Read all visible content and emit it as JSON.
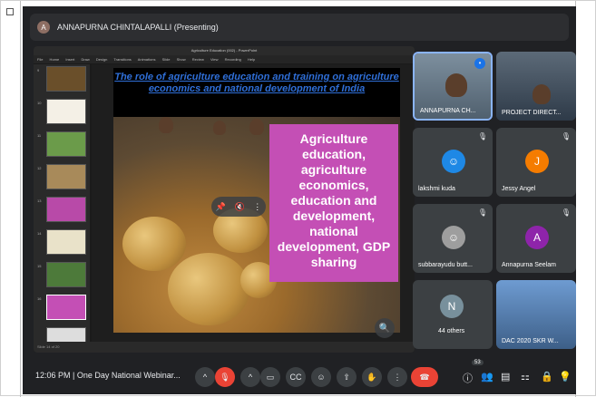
{
  "presenter": {
    "name": "ANNAPURNA CHINTALAPALLI (Presenting)"
  },
  "powerpoint": {
    "window_title": "Agriculture Education (002) - PowerPoint",
    "menu": "File Home Insert Draw Design Transitions Animations Slide Show Review View Recording Help",
    "status": "Slide 14 of 20",
    "slide": {
      "title": "The role of agriculture education and training on agriculture economics and national development of India",
      "box_text": "Agriculture education, agriculture economics, education and development, national development, GDP sharing"
    },
    "slide_numbers": [
      "9",
      "10",
      "11",
      "12",
      "13",
      "14",
      "15",
      "16"
    ]
  },
  "participants": [
    {
      "name": "ANNAPURNA CH...",
      "type": "video",
      "speaking": true
    },
    {
      "name": "PROJECT DIRECT...",
      "type": "video"
    },
    {
      "name": "lakshmi kuda",
      "type": "avatar-image",
      "muted": true
    },
    {
      "name": "Jessy Angel",
      "type": "letter",
      "letter": "J",
      "color": "#f57c00",
      "muted": true
    },
    {
      "name": "subbarayudu butt...",
      "type": "avatar-image",
      "muted": true
    },
    {
      "name": "Annapurna Seelam",
      "type": "letter",
      "letter": "A",
      "color": "#8e24aa",
      "muted": true
    },
    {
      "name": "44 others",
      "type": "others",
      "letter": "N"
    },
    {
      "name": "DAC 2020 SKR W...",
      "type": "video"
    }
  ],
  "bottom_bar": {
    "time": "12:06 PM",
    "meeting": "One Day National Webinar...",
    "participant_count": "53"
  },
  "colors": {
    "background": "#202124",
    "tile": "#3c4043",
    "red": "#ea4335",
    "pink_box": "#c44fb5",
    "title_blue": "#2f6fd8"
  }
}
